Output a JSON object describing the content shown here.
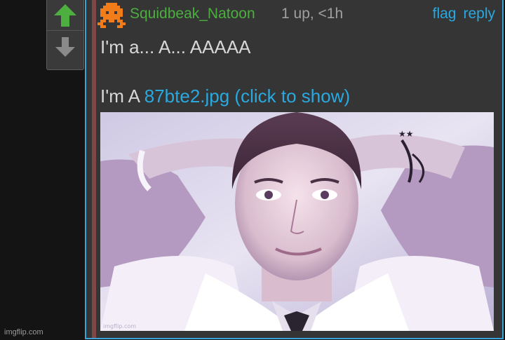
{
  "comment": {
    "username": "Squidbeak_Natoon",
    "meta": "1 up, <1h",
    "actions": {
      "flag": "flag",
      "reply": "reply"
    },
    "line1": "I'm a... A... AAAAA",
    "line2_prefix": "I'm A ",
    "file_link": "87bte2.jpg (click to show)",
    "image_watermark": "imgflip.com"
  },
  "page_watermark": "imgflip.com",
  "colors": {
    "accent": "#3aa3d8",
    "username": "#4caf3f",
    "link": "#29a9e0",
    "upvote": "#4caf3f",
    "downvote": "#8a8a8a"
  },
  "icons": {
    "upvote": "arrow-up-icon",
    "downvote": "arrow-down-icon"
  }
}
